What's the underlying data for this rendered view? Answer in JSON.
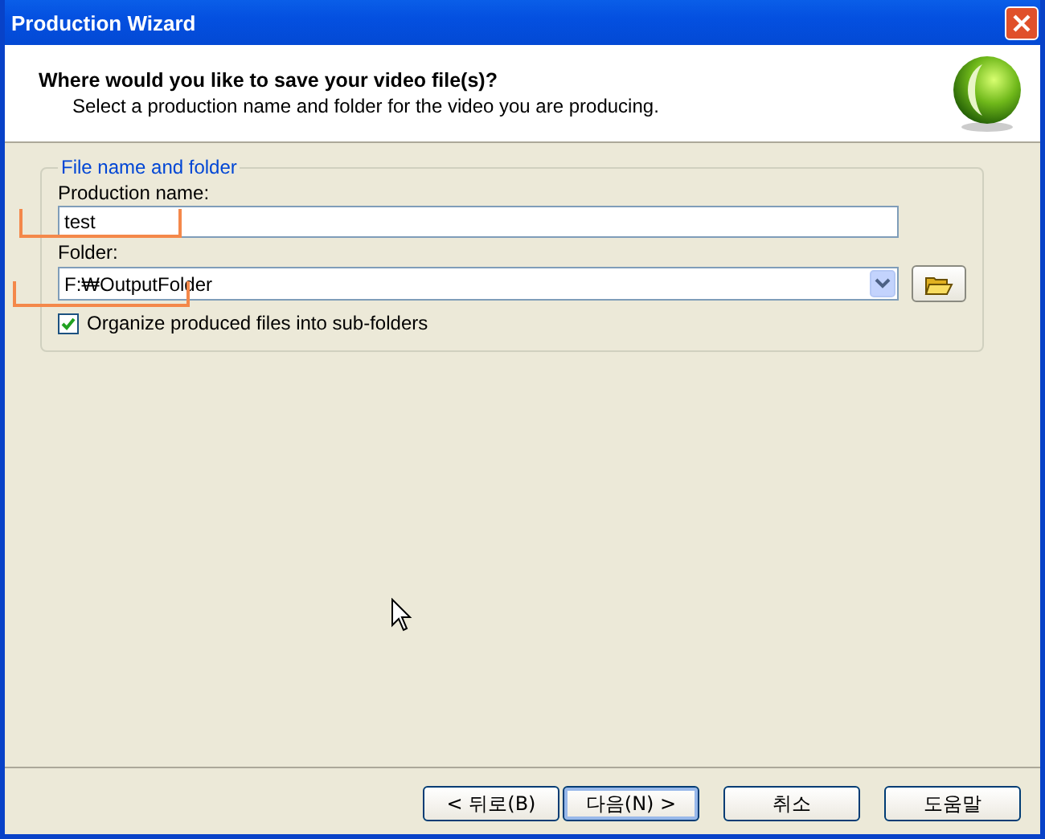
{
  "window": {
    "title": "Production Wizard"
  },
  "header": {
    "title": "Where would you like to save your video file(s)?",
    "subtitle": "Select a production name and folder for the video you are producing."
  },
  "group": {
    "title": "File name and folder",
    "production_name": {
      "label": "Production name:",
      "value": "test"
    },
    "folder": {
      "label": "Folder:",
      "value": "F:₩OutputFolder"
    },
    "organize": {
      "label": "Organize produced files into sub-folders",
      "checked": true
    }
  },
  "buttons": [
    {
      "label": "< 뒤로(B)",
      "default": false
    },
    {
      "label": "다음(N) >",
      "default": true
    },
    {
      "label": "취소",
      "default": false
    },
    {
      "label": "도움말",
      "default": false
    }
  ]
}
